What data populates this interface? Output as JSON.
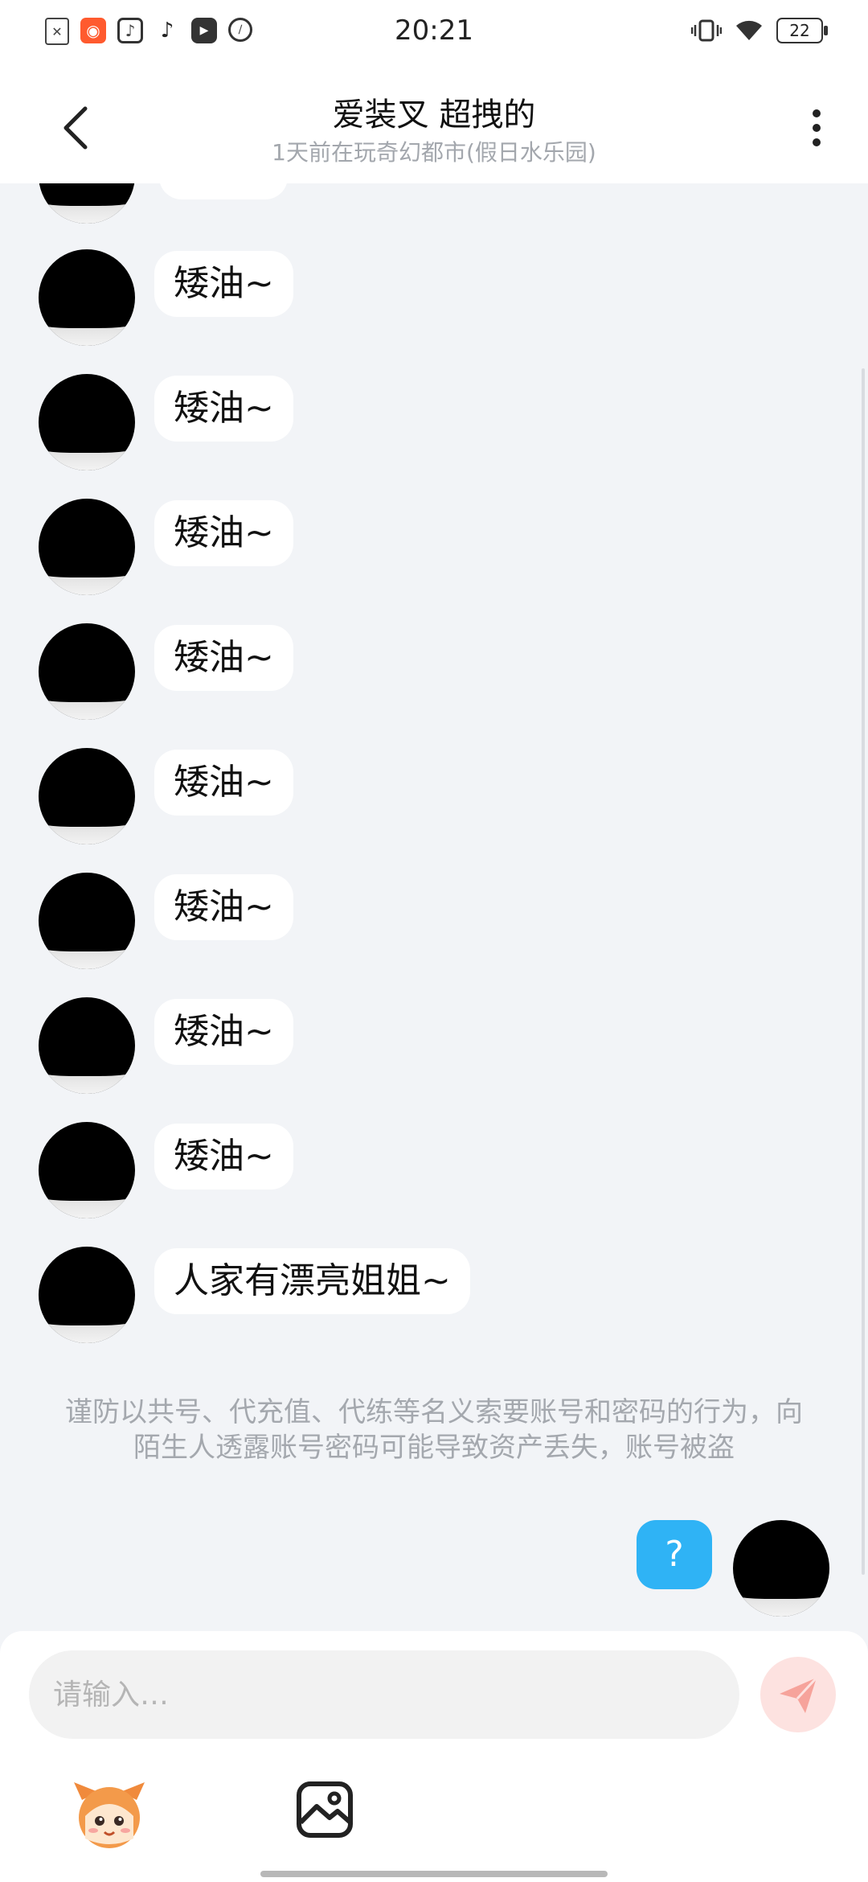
{
  "status_bar": {
    "time": "20:21",
    "battery": "22",
    "apps": [
      "close-app-icon",
      "kuaishou-icon",
      "music-icon",
      "tiktok-icon",
      "play-icon",
      "sketch-icon"
    ]
  },
  "header": {
    "title": "爱装叉 超拽的",
    "subtitle": "1天前在玩奇幻都市(假日水乐园)"
  },
  "messages": [
    {
      "text": "矮油~"
    },
    {
      "text": "矮油~"
    },
    {
      "text": "矮油~"
    },
    {
      "text": "矮油~"
    },
    {
      "text": "矮油~"
    },
    {
      "text": "矮油~"
    },
    {
      "text": "矮油~"
    },
    {
      "text": "矮油~"
    },
    {
      "text": "人家有漂亮姐姐~"
    }
  ],
  "warning": "谨防以共号、代充值、代练等名义索要账号和密码的行为，向陌生人透露账号密码可能导致资产丢失，账号被盗",
  "self_message": {
    "text": "?",
    "color": "#2fb3f5"
  },
  "input": {
    "placeholder": "请输入…",
    "value": ""
  },
  "colors": {
    "background": "#f2f4f7",
    "send_button": "#fde2e0",
    "send_icon": "#f6a39b"
  }
}
